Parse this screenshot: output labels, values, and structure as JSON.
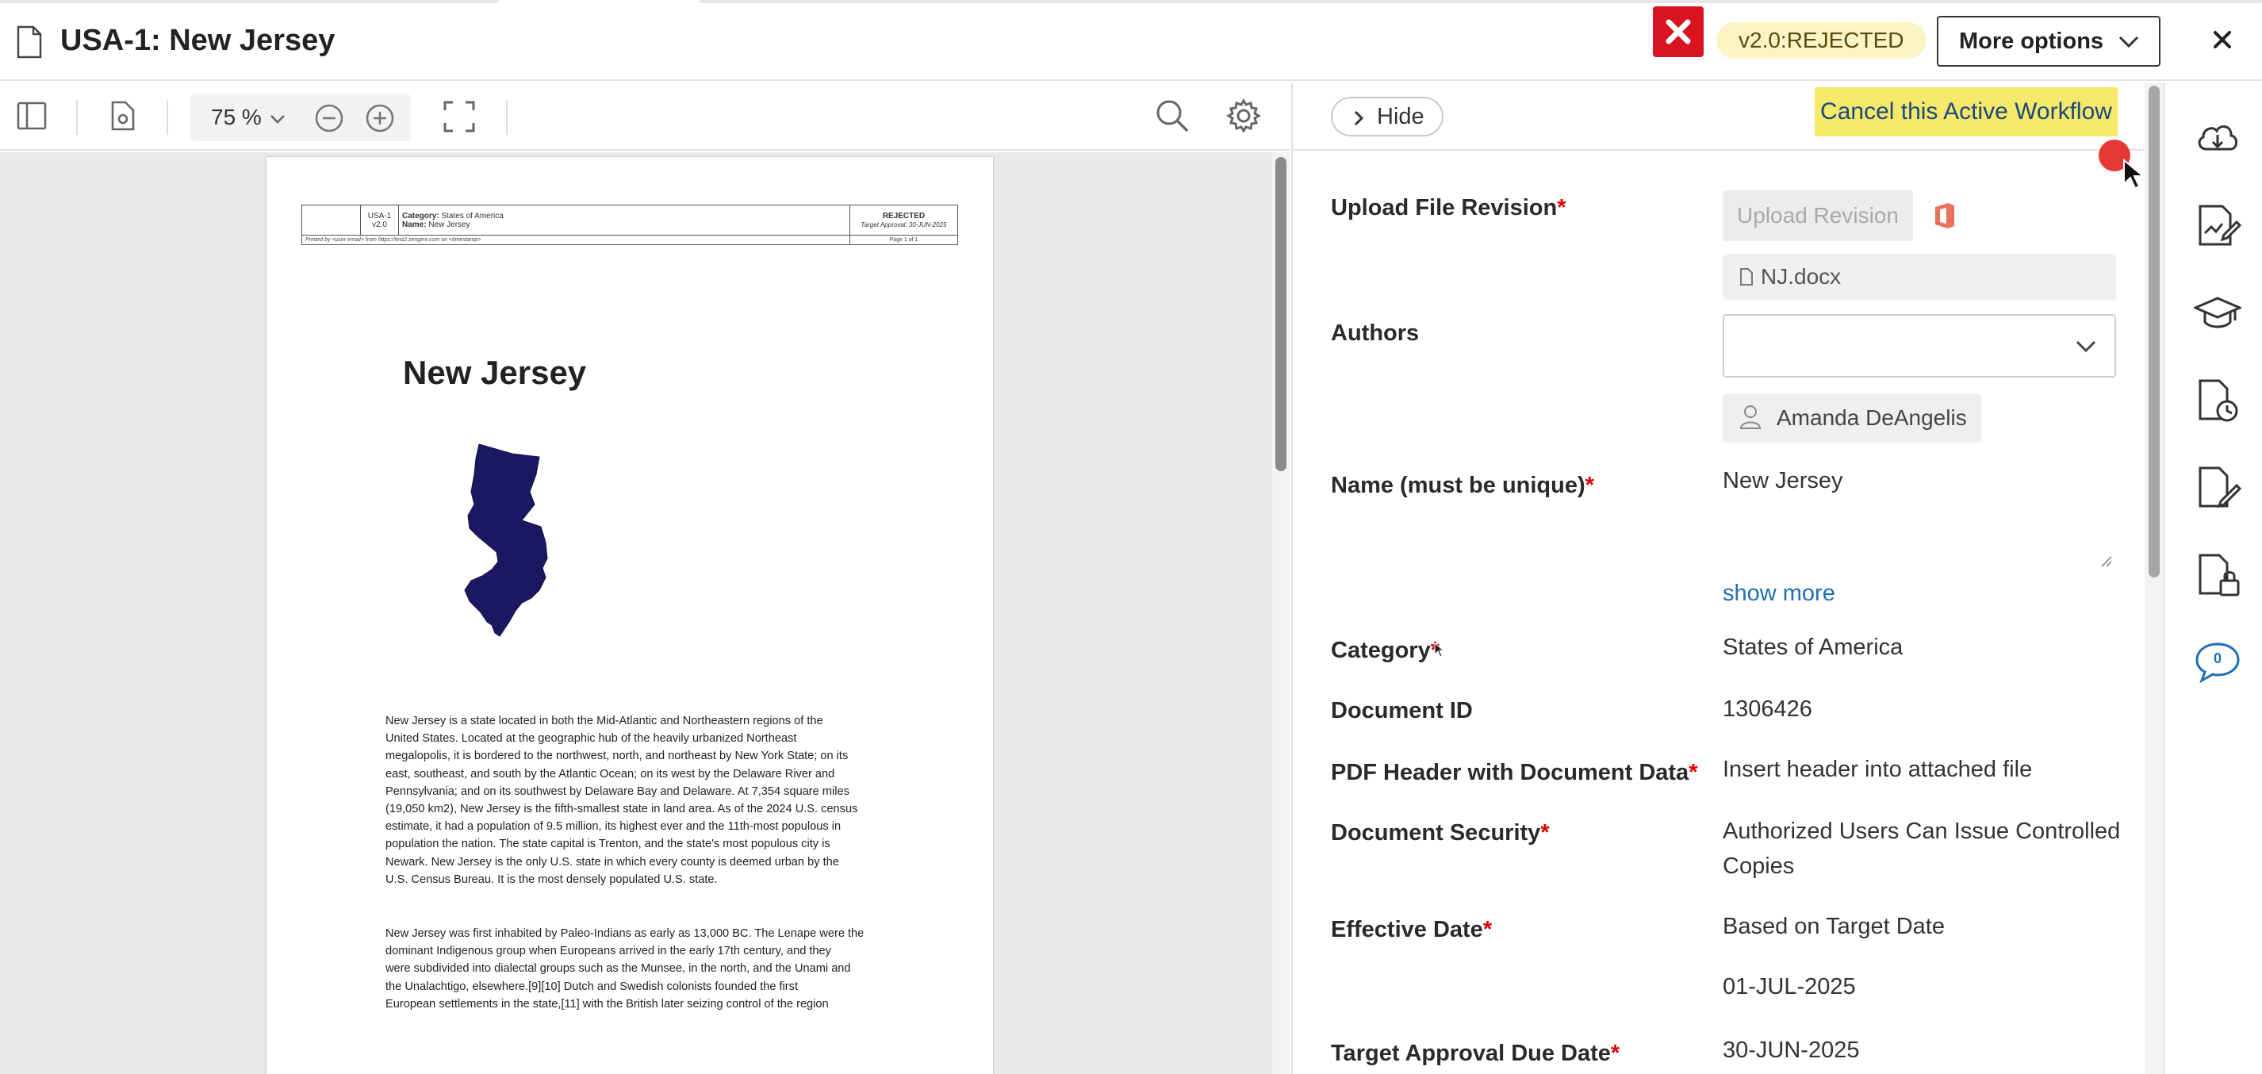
{
  "window": {
    "title": "USA-1: New Jersey",
    "status_badge": "v2.0:REJECTED",
    "more_options_label": "More options"
  },
  "viewer_toolbar": {
    "zoom": "75 %"
  },
  "document": {
    "header": {
      "id": "USA-1",
      "version": "v2.0",
      "category_label": "Category:",
      "category_value": "States of America",
      "name_label": "Name:",
      "name_value": "New Jersey",
      "status": "REJECTED",
      "target_approval": "Target Approval: 30-JUN-2025",
      "printed_by": "Printed by <user email> from https://test2.zenginx.com on <timestamp>",
      "page": "Page 1 of 1"
    },
    "title": "New Jersey",
    "paragraph1_lines": [
      "New Jersey is a state located in both the Mid-Atlantic and Northeastern regions of the",
      "United States. Located at the geographic hub of the heavily urbanized Northeast",
      "megalopolis, it is bordered to the northwest, north, and northeast by New York State; on its",
      "east, southeast, and south by the Atlantic Ocean; on its west by the Delaware River and",
      "Pennsylvania; and on its southwest by Delaware Bay and Delaware. At 7,354 square miles",
      "(19,050 km2), New Jersey is the fifth-smallest state in land area. As of the 2024 U.S. census",
      "estimate, it had a population of 9.5 million, its highest ever and the 11th-most populous in",
      "population the nation. The state capital is Trenton, and the state's most populous city is",
      "Newark. New Jersey is the only U.S. state in which every county is deemed urban by the",
      "U.S. Census Bureau. It is the most densely populated U.S. state."
    ],
    "paragraph2_lines": [
      "New Jersey was first inhabited by Paleo-Indians as early as 13,000 BC. The Lenape were the",
      "dominant Indigenous group when Europeans arrived in the early 17th century, and they",
      "were subdivided into dialectal groups such as the Munsee, in the north, and the Unami and",
      "the Unalachtigo, elsewhere.[9][10] Dutch and Swedish colonists founded the first",
      "European settlements in the state,[11] with the British later seizing control of the region"
    ]
  },
  "panel": {
    "hide_label": "Hide",
    "cancel_workflow_label": "Cancel this Active Workflow",
    "upload_revision_label": "Upload File Revision",
    "upload_revision_button": "Upload Revision",
    "file_name": "NJ.docx",
    "authors_label": "Authors",
    "author_name": "Amanda DeAngelis",
    "name_label": "Name (must be unique)",
    "name_value": "New Jersey",
    "show_more": "show more",
    "category_label": "Category",
    "category_value": "States of America",
    "document_id_label": "Document ID",
    "document_id_value": "1306426",
    "pdf_header_label": "PDF Header with Document Data",
    "pdf_header_value": "Insert header into attached file",
    "security_label": "Document Security",
    "security_value_line1": "Authorized Users Can Issue Controlled",
    "security_value_line2": "Copies",
    "effective_date_label": "Effective Date",
    "effective_date_value": "Based on Target Date",
    "effective_date_date": "01-JUL-2025",
    "target_date_label": "Target Approval Due Date",
    "target_date_value": "30-JUN-2025",
    "required_mark": "*"
  },
  "rail": {
    "comments_count": "0",
    "icons": [
      "cloud-download-icon",
      "signature-chart-icon",
      "training-cap-icon",
      "document-history-icon",
      "document-edit-icon",
      "document-lock-icon",
      "comments-icon"
    ]
  },
  "colors": {
    "reject_red": "#d9131f",
    "badge_yellow": "#fbf5c6",
    "cancel_yellow": "#f5e86b",
    "link_blue": "#1f6fb6",
    "map_navy": "#1b1760",
    "required_red": "#dd0000"
  }
}
